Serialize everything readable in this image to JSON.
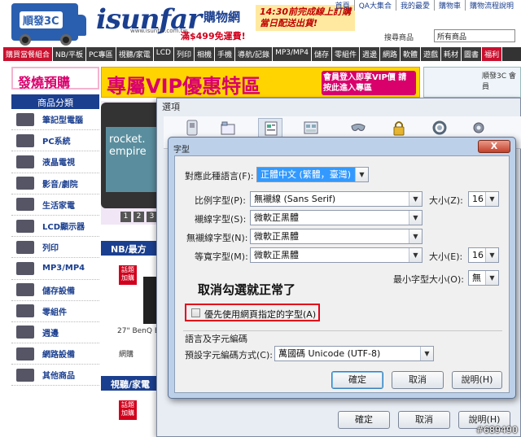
{
  "site": {
    "badge": "順發3C",
    "logo": "isunfar",
    "logo_sub": "購物網",
    "logo_url": "www.isunfar.com.tw",
    "promo": "滿$499免運費!",
    "slogan_line1": "14:30前完成線上訂購",
    "slogan_line2": "當日配送出貨!",
    "top_links": [
      "首頁",
      "QA大集合",
      "我的最愛",
      "購物車",
      "購物流程說明"
    ],
    "search_label": "搜尋商品",
    "search_scope": "所有商品",
    "nav": [
      "購買當餐組合",
      "NB/平板",
      "PC專區",
      "視聽/家電",
      "LCD",
      "列印",
      "相機",
      "手機",
      "導航/記錄",
      "MP3/MP4",
      "儲存",
      "零組件",
      "週邊",
      "網路",
      "軟體",
      "遊戲",
      "耗材",
      "圖書",
      "福利"
    ],
    "side_title": "發燒預購",
    "category_header": "商品分類",
    "categories": [
      "筆記型電腦",
      "PC系統",
      "液晶電視",
      "影音/劇院",
      "生活家電",
      "LCD顯示器",
      "列印",
      "MP3/MP4",
      "儲存設備",
      "零組件",
      "週邊",
      "網路設備",
      "其他商品"
    ],
    "banner_text": "專屬VIP優惠特區",
    "banner_sub": "會員登入即享VIP價 請按此進入專區",
    "member_title": "順發3C 會員",
    "phone_text": "rocket. empire",
    "pager": [
      "1",
      "2",
      "3"
    ],
    "section_nb": "NB/最方",
    "section_av": "視聽/家電",
    "badge_text": "話題 加購",
    "product_name": "27\" BenQ E",
    "product_sub": "網購"
  },
  "options_dialog": {
    "title": "選項",
    "tabs": [
      "一般",
      "分頁",
      "內容",
      "應用程式",
      "隱私權",
      "安全",
      "同步",
      "進階"
    ],
    "ok_label": "確定",
    "cancel_label": "取消",
    "help_label": "說明(H)"
  },
  "fonts_dialog": {
    "title": "字型",
    "close_label": "X",
    "language_label": "對應此種語言(F):",
    "language_value": "正體中文 (繁體，臺灣)",
    "proportional_label": "比例字型(P):",
    "proportional_value": "無襯線 (Sans Serif)",
    "size_label": "大小(Z):",
    "size_value": "16",
    "serif_label": "襯線字型(S):",
    "serif_value": "微軟正黑體",
    "sans_label": "無襯線字型(N):",
    "sans_value": "微軟正黑體",
    "mono_label": "等寬字型(M):",
    "mono_value": "微軟正黑體",
    "mono_size_label": "大小(E):",
    "mono_size_value": "16",
    "min_size_label": "最小字型大小(O):",
    "min_size_value": "無",
    "annotation": "取消勾選就正常了",
    "allow_pages_label": "優先使用網頁指定的字型(A)",
    "allow_pages_checked": false,
    "encoding_section": "語言及字元編碼",
    "encoding_label": "預設字元編碼方式(C):",
    "encoding_value": "萬國碼 Unicode (UTF-8)",
    "ok_label": "確定",
    "cancel_label": "取消",
    "help_label": "說明(H)"
  },
  "watermark": "#689490"
}
